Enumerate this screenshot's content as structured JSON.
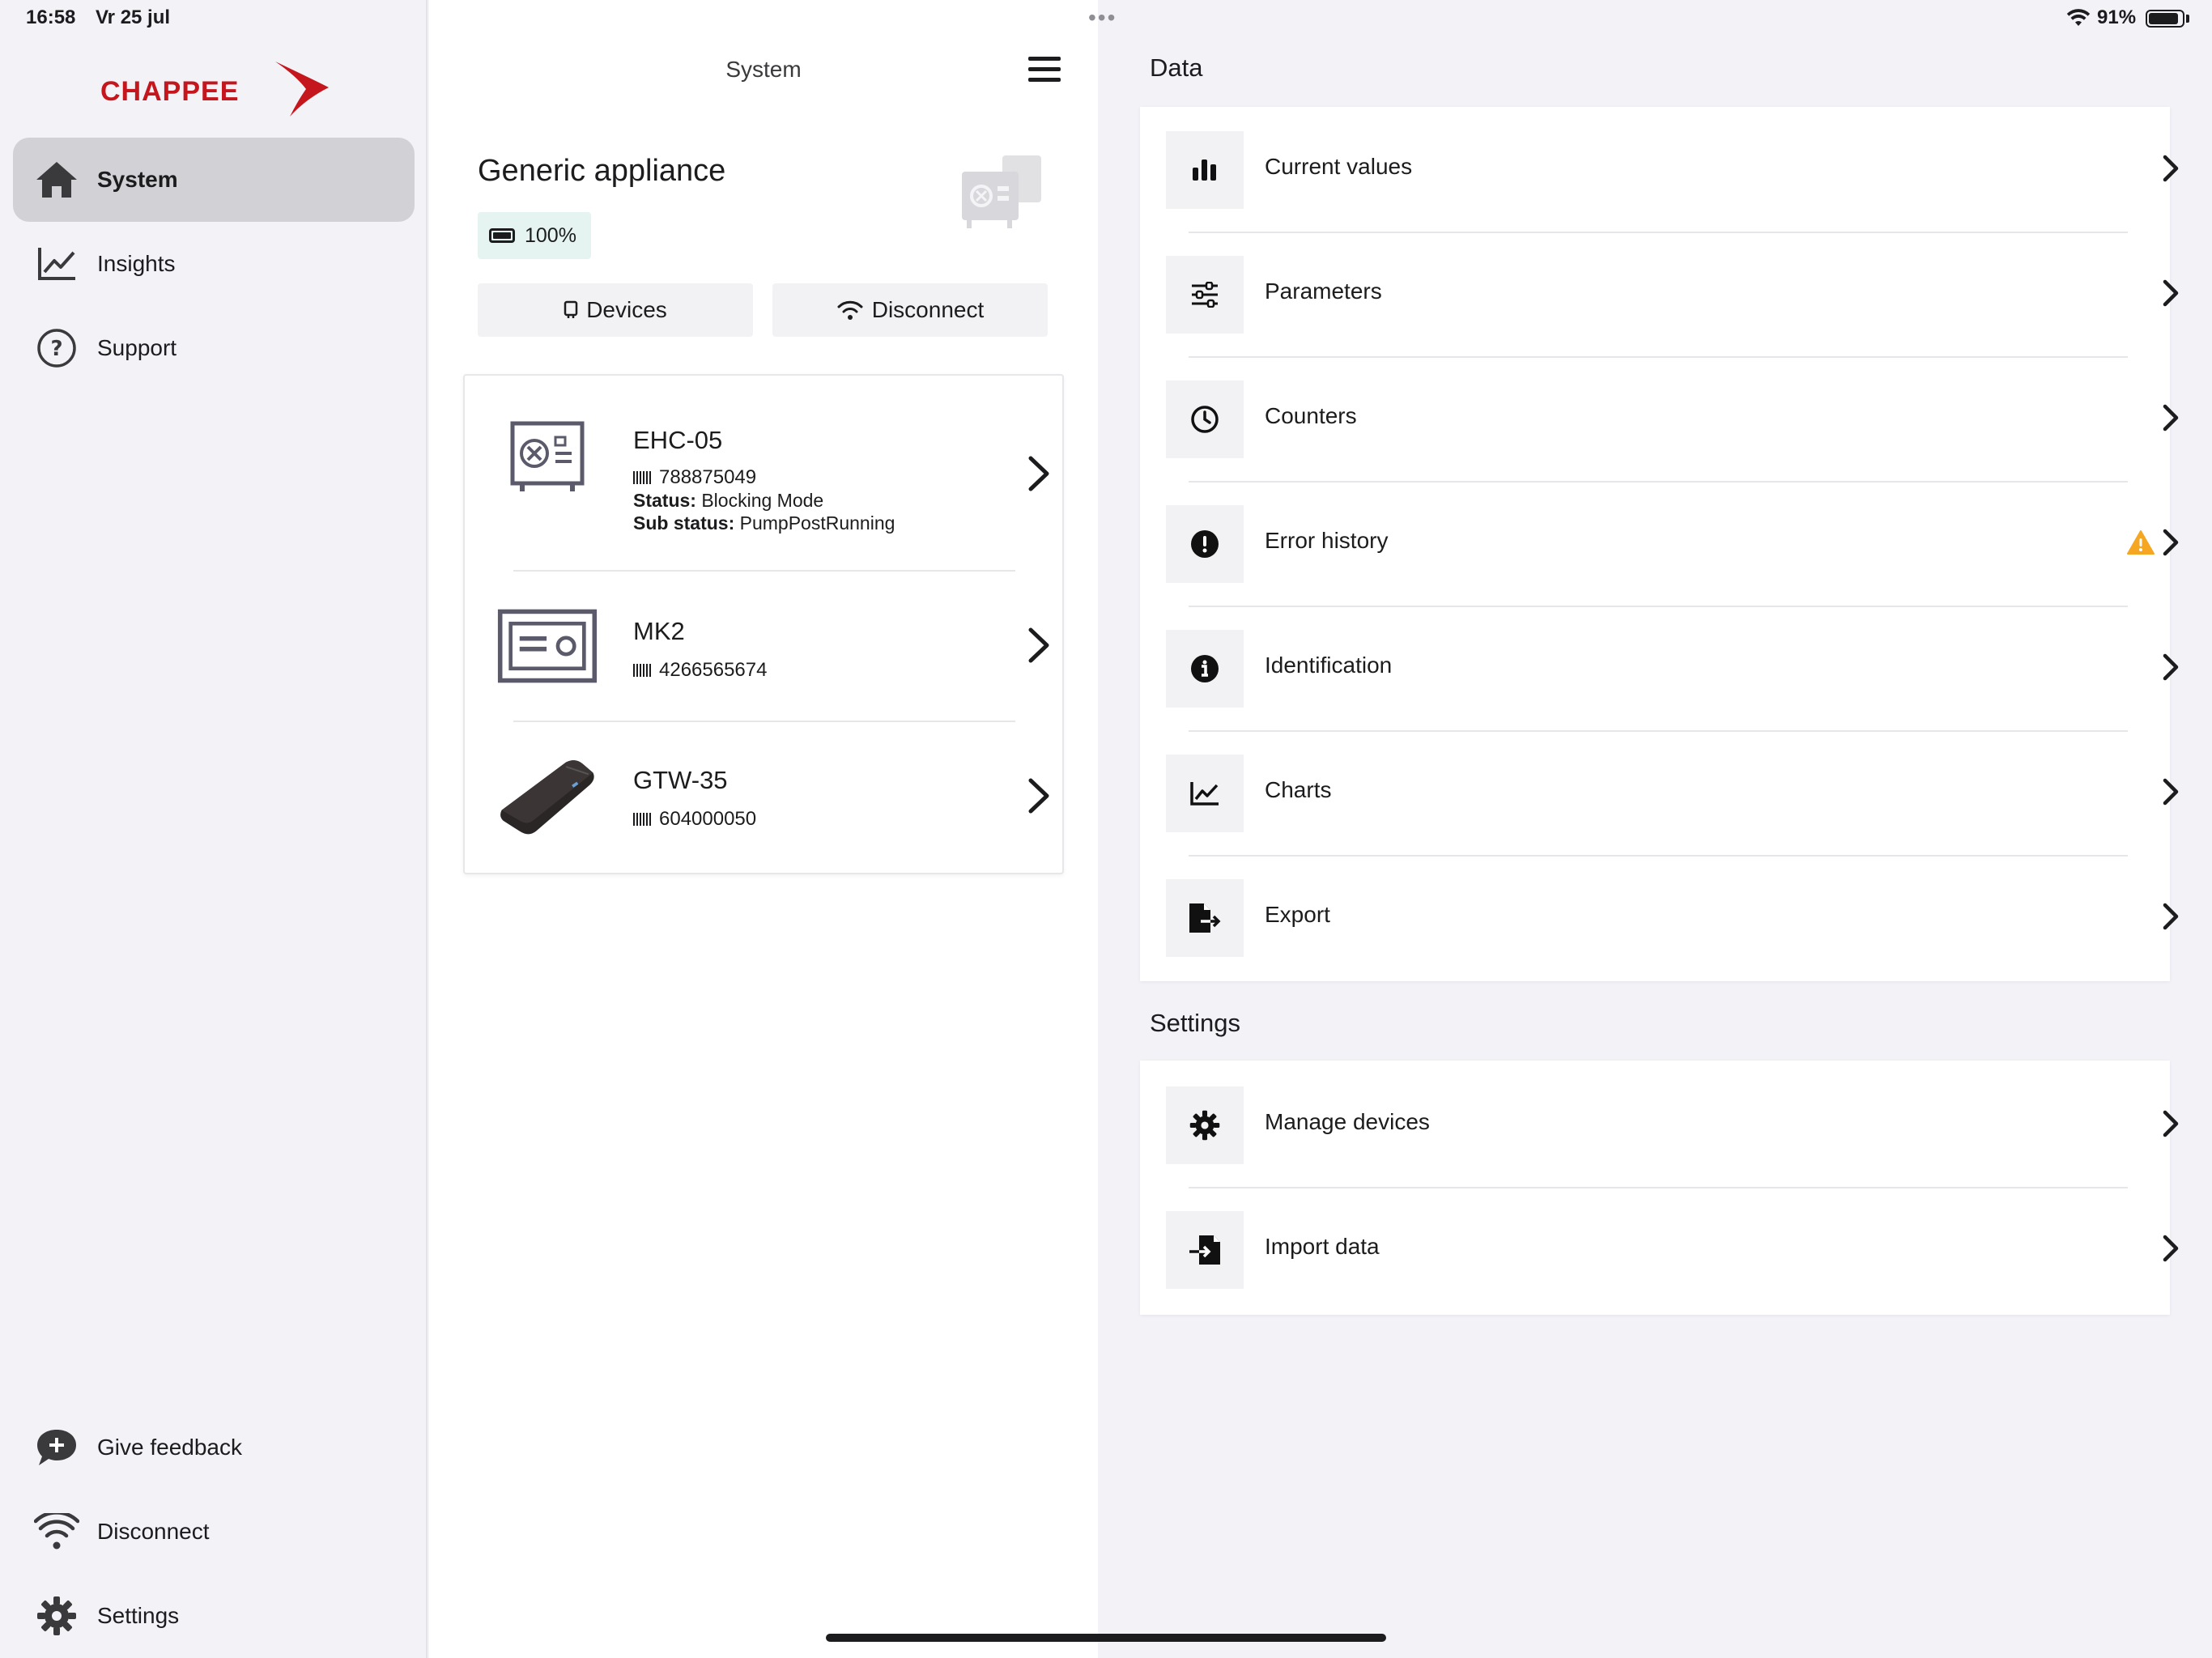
{
  "status_bar": {
    "time": "16:58",
    "date": "Vr 25 jul",
    "battery_percent": "91%",
    "battery_level": 0.91
  },
  "brand": {
    "logo_text": "CHAPPEE",
    "accent_color": "#c4161c"
  },
  "sidebar": {
    "items": [
      {
        "label": "System",
        "icon": "home-icon",
        "active": true
      },
      {
        "label": "Insights",
        "icon": "chart-line-icon",
        "active": false
      },
      {
        "label": "Support",
        "icon": "question-circle-icon",
        "active": false
      }
    ],
    "bottom_items": [
      {
        "label": "Give feedback",
        "icon": "chat-plus-icon"
      },
      {
        "label": "Disconnect",
        "icon": "wifi-icon"
      },
      {
        "label": "Settings",
        "icon": "gear-icon"
      }
    ]
  },
  "system": {
    "title": "System",
    "appliance_name": "Generic appliance",
    "battery": "100%",
    "battery_badge_color": "#e5f4f1",
    "devices_button": "Devices",
    "disconnect_button": "Disconnect",
    "devices": [
      {
        "name": "EHC-05",
        "serial": "788875049",
        "status_label": "Status:",
        "status": "Blocking Mode",
        "sub_status_label": "Sub status:",
        "sub_status": "PumpPostRunning",
        "icon": "controller-panel-icon"
      },
      {
        "name": "MK2",
        "serial": "4266565674",
        "icon": "module-box-icon"
      },
      {
        "name": "GTW-35",
        "serial": "604000050",
        "icon": "gateway-device-icon"
      }
    ]
  },
  "data_section": {
    "title": "Data",
    "items": [
      {
        "label": "Current values",
        "icon": "bar-chart-icon"
      },
      {
        "label": "Parameters",
        "icon": "sliders-icon"
      },
      {
        "label": "Counters",
        "icon": "clock-icon"
      },
      {
        "label": "Error history",
        "icon": "exclamation-circle-icon",
        "warning": true
      },
      {
        "label": "Identification",
        "icon": "info-circle-icon"
      },
      {
        "label": "Charts",
        "icon": "line-chart-icon"
      },
      {
        "label": "Export",
        "icon": "file-export-icon"
      }
    ]
  },
  "settings_section": {
    "title": "Settings",
    "items": [
      {
        "label": "Manage devices",
        "icon": "gear-icon"
      },
      {
        "label": "Import data",
        "icon": "file-import-icon"
      }
    ]
  },
  "colors": {
    "warning": "#f5a623",
    "background": "#f2f2f7",
    "active_nav": "#d1d1d6"
  }
}
